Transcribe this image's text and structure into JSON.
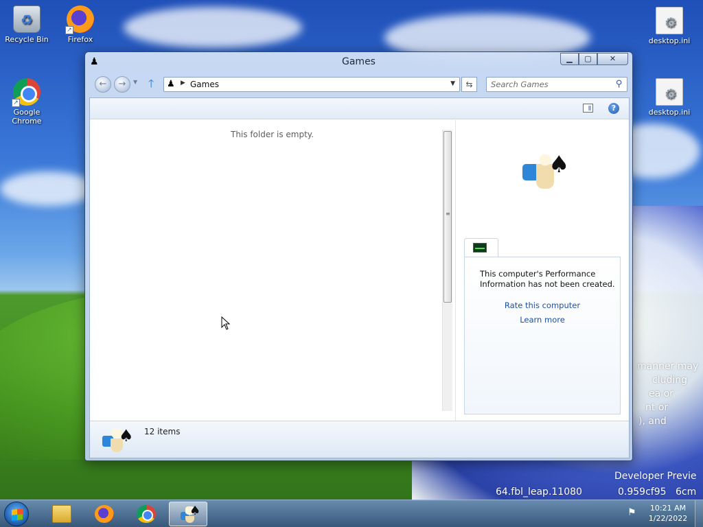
{
  "desktop": {
    "icons": [
      {
        "label": "Recycle Bin"
      },
      {
        "label": "Firefox"
      },
      {
        "label": "Google Chrome"
      },
      {
        "label": "desktop.ini"
      },
      {
        "label": "desktop.ini"
      }
    ],
    "wallpaper_text": [
      "manner may",
      "cluding",
      "ea or",
      "nt or",
      "), and",
      "Developer Previe",
      "64.fbl_leap.11080",
      "0.959cf95",
      "6cm"
    ]
  },
  "window": {
    "title": "Games",
    "caption_buttons": {
      "minimize": "▁",
      "maximize": "▢",
      "close": "✕"
    },
    "address": {
      "crumb": "Games"
    },
    "search": {
      "placeholder": "Search Games"
    },
    "filelist": {
      "empty_message": "This folder is empty."
    },
    "preview": {
      "perf_message": "This computer's Performance Information has not been created.",
      "rate_link": "Rate this computer",
      "learn_link": "Learn more"
    },
    "details": {
      "item_count": "12 items"
    }
  },
  "taskbar": {
    "clock_time": "10:21 AM",
    "clock_date": "1/22/2022",
    "colors": {
      "accent": "#1f5fb8"
    }
  }
}
